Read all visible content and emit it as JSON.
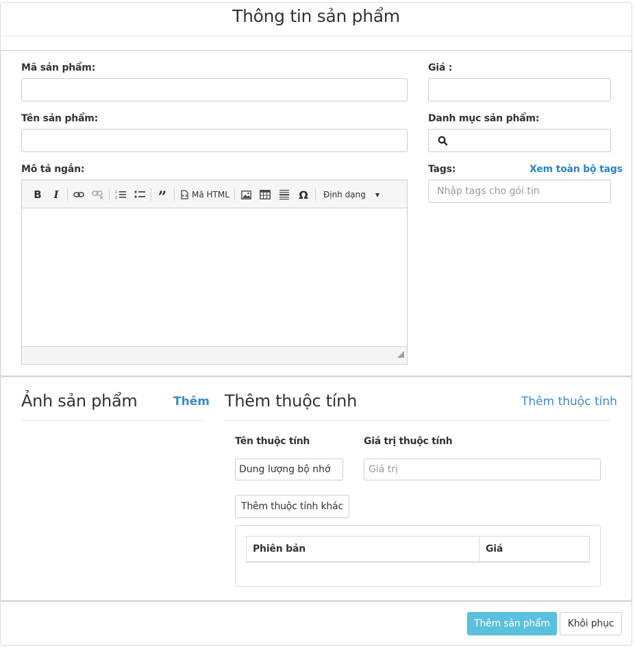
{
  "header": {
    "title": "Thông tin sản phẩm"
  },
  "form": {
    "code_label": "Mã sản phẩm:",
    "code_value": "",
    "name_label": "Tên sản phẩm:",
    "name_value": "",
    "desc_label": "Mô tả ngắn:",
    "price_label": "Giá :",
    "price_value": "",
    "category_label": "Danh mục sản phẩm:",
    "category_value": "",
    "tags_label": "Tags:",
    "tags_link": "Xem toàn bộ tags",
    "tags_placeholder": "Nhập tags cho gói tin"
  },
  "editor": {
    "html_label": "Mã HTML",
    "format_label": "Định dạng",
    "icons": [
      "bold-icon",
      "italic-icon",
      "link-icon",
      "unlink-icon",
      "numbered-list-icon",
      "bullet-list-icon",
      "blockquote-icon",
      "source-icon",
      "image-icon",
      "table-icon",
      "horizontal-rule-icon",
      "special-char-icon",
      "dropdown-caret-icon",
      "resize-handle-icon"
    ]
  },
  "images": {
    "title": "Ảnh sản phẩm",
    "add_link": "Thêm"
  },
  "attributes": {
    "title": "Thêm thuộc tính",
    "add_link": "Thêm thuộc tính",
    "name_header": "Tên thuộc tính",
    "value_header": "Giá trị thuộc tính",
    "name_value": "Dung lượng bộ nhớ",
    "value_placeholder": "Giá trị",
    "add_other_button": "Thêm thuộc tính khác",
    "variants": {
      "col_version": "Phiên bản",
      "col_price": "Giá"
    }
  },
  "footer": {
    "submit_button": "Thêm sản phẩm",
    "reset_button": "Khôi phục"
  },
  "colors": {
    "primary": "#5bc0de",
    "link": "#2f83c7"
  }
}
